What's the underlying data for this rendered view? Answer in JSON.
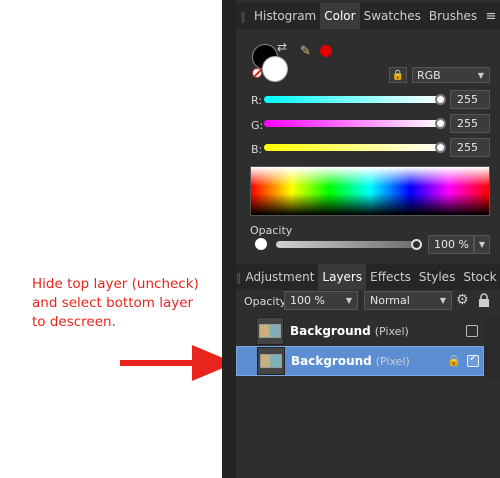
{
  "annotation": {
    "lines": [
      "Hide top layer (uncheck)",
      "and select bottom layer",
      "to descreen."
    ],
    "color": "#e8241c"
  },
  "top_tabs": {
    "items": [
      "Histogram",
      "Color",
      "Swatches",
      "Brushes"
    ],
    "active": "Color"
  },
  "color_panel": {
    "mode": "RGB",
    "sliders": [
      {
        "label": "R:",
        "value": "255"
      },
      {
        "label": "G:",
        "value": "255"
      },
      {
        "label": "B:",
        "value": "255"
      }
    ],
    "opacity_label": "Opacity",
    "opacity_value": "100 %",
    "opacity_fraction": 1.0,
    "fill_color": "#000000",
    "stroke_color": "#ffffff",
    "recent_color": "#e30000"
  },
  "bottom_tabs": {
    "items": [
      "Adjustment",
      "Layers",
      "Effects",
      "Styles",
      "Stock"
    ],
    "active": "Layers"
  },
  "layers_panel": {
    "opacity_label": "Opacity:",
    "opacity_value": "100 %",
    "blend_mode": "Normal",
    "layers": [
      {
        "name": "Background",
        "type": "(Pixel)",
        "visible": false,
        "selected": false,
        "locked": false
      },
      {
        "name": "Background",
        "type": "(Pixel)",
        "visible": true,
        "selected": true,
        "locked": true
      }
    ]
  },
  "icons": {
    "tab_menu": "menu-icon",
    "gear": "gear-icon",
    "lock": "lock-icon",
    "swap": "swap-colors-icon",
    "picker": "color-picker-icon",
    "arrow": "red-right-arrow"
  }
}
